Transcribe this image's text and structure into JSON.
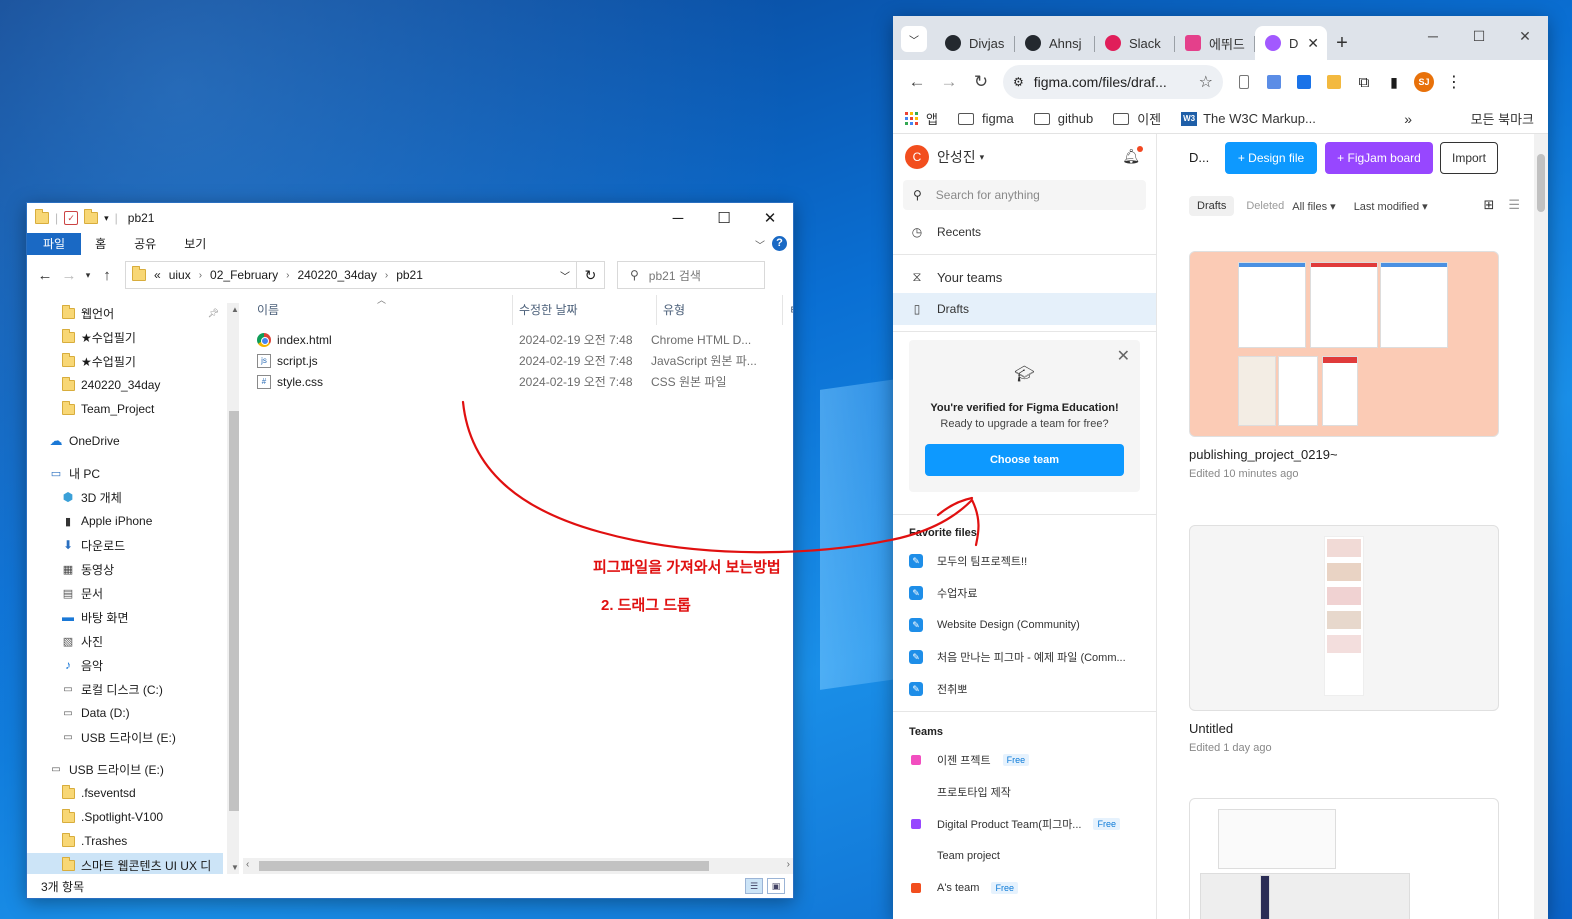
{
  "explorer": {
    "title": "pb21",
    "ribbon_tabs": [
      "파일",
      "홈",
      "공유",
      "보기"
    ],
    "address_prefix": "«",
    "address": [
      "uiux",
      "02_February",
      "240220_34day",
      "pb21"
    ],
    "search_placeholder": "pb21 검색",
    "columns": [
      "이름",
      "수정한 날짜",
      "유형"
    ],
    "nav_items": [
      {
        "label": "웹언어",
        "icon": "folder-icon"
      },
      {
        "label": "★수업필기",
        "icon": "folder-icon"
      },
      {
        "label": "★수업필기",
        "icon": "folder-icon"
      },
      {
        "label": "240220_34day",
        "icon": "folder-icon"
      },
      {
        "label": "Team_Project",
        "icon": "folder-icon"
      },
      {
        "label": "OneDrive",
        "icon": "cloud-icon"
      },
      {
        "label": "내 PC",
        "icon": "pc-icon"
      },
      {
        "label": "3D 개체",
        "icon": "cube-icon"
      },
      {
        "label": "Apple iPhone",
        "icon": "phone-icon"
      },
      {
        "label": "다운로드",
        "icon": "download-icon"
      },
      {
        "label": "동영상",
        "icon": "video-icon"
      },
      {
        "label": "문서",
        "icon": "document-icon"
      },
      {
        "label": "바탕 화면",
        "icon": "desktop-icon"
      },
      {
        "label": "사진",
        "icon": "picture-icon"
      },
      {
        "label": "음악",
        "icon": "music-icon"
      },
      {
        "label": "로컬 디스크 (C:)",
        "icon": "drive-icon"
      },
      {
        "label": "Data (D:)",
        "icon": "drive-icon"
      },
      {
        "label": "USB 드라이브 (E:)",
        "icon": "usb-drive-icon"
      },
      {
        "label": "USB 드라이브 (E:)",
        "icon": "usb-drive-icon"
      },
      {
        "label": ".fseventsd",
        "icon": "folder-icon"
      },
      {
        "label": ".Spotlight-V100",
        "icon": "folder-icon"
      },
      {
        "label": ".Trashes",
        "icon": "folder-icon"
      },
      {
        "label": "스마트 웹콘텐츠 UI  UX 디",
        "icon": "folder-icon"
      }
    ],
    "files": [
      {
        "name": "index.html",
        "date": "2024-02-19 오전 7:48",
        "type": "Chrome HTML D..."
      },
      {
        "name": "script.js",
        "date": "2024-02-19 오전 7:48",
        "type": "JavaScript 원본 파..."
      },
      {
        "name": "style.css",
        "date": "2024-02-19 오전 7:48",
        "type": "CSS 원본 파일"
      }
    ],
    "status": "3개 항목"
  },
  "chrome": {
    "tabs": [
      {
        "label": "Divjas",
        "color": "#24292f"
      },
      {
        "label": "Ahnsj",
        "color": "#24292f"
      },
      {
        "label": "Slack",
        "color": "#e01e5a"
      },
      {
        "label": "에뛰드",
        "color": "#e4408b"
      },
      {
        "label": "D",
        "color": "#a259ff"
      }
    ],
    "url": "figma.com/files/draf...",
    "profile_initials": "SJ",
    "bookmarks": [
      "앱",
      "figma",
      "github",
      "이젠",
      "The W3C Markup..."
    ],
    "all_bookmarks": "모든 북마크"
  },
  "figma": {
    "user_name": "안성진",
    "user_initial": "C",
    "search_placeholder": "Search for anything",
    "recents": "Recents",
    "your_teams": "Your teams",
    "drafts": "Drafts",
    "edu_title": "You're verified for Figma Education!",
    "edu_sub": "Ready to upgrade a team for free?",
    "edu_button": "Choose team",
    "favorites_title": "Favorite files",
    "favorites": [
      "모두의 팀프로젝트!!",
      "수업자료",
      "Website Design (Community)",
      "처음 만나는 피그마 - 예제 파일 (Comm...",
      "전취뽀"
    ],
    "teams_title": "Teams",
    "teams": [
      {
        "name": "이젠 프젝트",
        "free": "Free",
        "color": "#f24ec0"
      },
      {
        "name": "프로토타입 제작",
        "free": "",
        "color": ""
      },
      {
        "name": "Digital Product Team(피그마...",
        "free": "Free",
        "color": "#9747ff"
      },
      {
        "name": "Team project",
        "free": "",
        "color": ""
      },
      {
        "name": "A's team",
        "free": "Free",
        "color": "#f24e1e"
      }
    ],
    "header_title": "D...",
    "btn_design": "+ Design file",
    "btn_figjam": "+ FigJam board",
    "btn_import": "Import",
    "filter_drafts": "Drafts",
    "filter_deleted": "Deleted",
    "filter_all": "All files ▾",
    "filter_sort": "Last modified ▾",
    "files": [
      {
        "name": "publishing_project_0219~",
        "edited": "Edited 10 minutes ago",
        "bg": "#fbcbb5"
      },
      {
        "name": "Untitled",
        "edited": "Edited 1 day ago",
        "bg": "#f5f5f5"
      }
    ]
  },
  "annotation": {
    "line1": "피그파일을 가져와서 보는방법",
    "line2": "2. 드래그 드롭",
    "color": "#e01010"
  }
}
